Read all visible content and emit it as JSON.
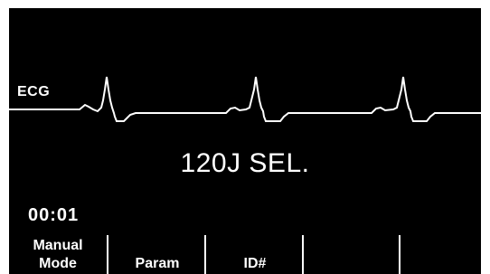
{
  "monitor": {
    "lead_label": "ECG",
    "energy_text": "120J SEL.",
    "elapsed_time": "00:01",
    "trace_color": "#ffffff",
    "background_color": "#000000"
  },
  "softkeys": [
    {
      "line1": "Manual",
      "line2": "Mode"
    },
    {
      "line1": "",
      "line2": "Param"
    },
    {
      "line1": "",
      "line2": "ID#"
    },
    {
      "line1": "",
      "line2": ""
    },
    {
      "line1": "",
      "line2": ""
    }
  ]
}
